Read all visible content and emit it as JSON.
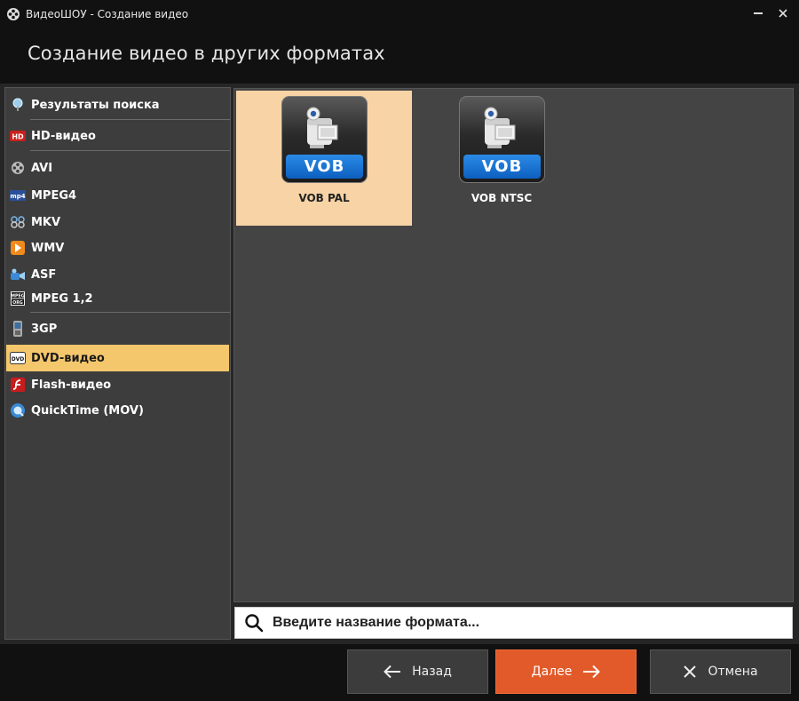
{
  "window": {
    "title": "ВидеоШОУ - Создание видео",
    "minimize_icon": "minimize-icon",
    "close_icon": "close-icon"
  },
  "header": {
    "heading": "Создание видео в других форматах"
  },
  "sidebar": {
    "items": [
      {
        "label": "Результаты поиска",
        "icon": "search-result-icon",
        "selected": false
      },
      {
        "label": "HD-видео",
        "icon": "hd-icon",
        "selected": false
      },
      {
        "label": "AVI",
        "icon": "film-reel-icon",
        "selected": false
      },
      {
        "label": "MPEG4",
        "icon": "mp4-icon",
        "selected": false
      },
      {
        "label": "MKV",
        "icon": "mkv-icon",
        "selected": false
      },
      {
        "label": "WMV",
        "icon": "wmv-icon",
        "selected": false
      },
      {
        "label": "ASF",
        "icon": "asf-icon",
        "selected": false
      },
      {
        "label": "MPEG 1,2",
        "icon": "mpeg-org-icon",
        "selected": false
      },
      {
        "label": "3GP",
        "icon": "phone-icon",
        "selected": false
      },
      {
        "label": "DVD-видео",
        "icon": "dvd-icon",
        "selected": true
      },
      {
        "label": "Flash-видео",
        "icon": "flash-icon",
        "selected": false
      },
      {
        "label": "QuickTime (MOV)",
        "icon": "quicktime-icon",
        "selected": false
      }
    ]
  },
  "formats": [
    {
      "label": "VOB PAL",
      "badge": "VOB",
      "icon": "camcorder-icon",
      "selected": true
    },
    {
      "label": "VOB NTSC",
      "badge": "VOB",
      "icon": "camcorder-icon",
      "selected": false
    }
  ],
  "search": {
    "placeholder": "Введите название формата...",
    "icon": "search-icon"
  },
  "buttons": {
    "back": "Назад",
    "next": "Далее",
    "cancel": "Отмена"
  },
  "colors": {
    "selected_item": "#f5c76c",
    "selected_tile": "#f7d3a6",
    "primary_button": "#e25a2a",
    "badge_blue": "#1a73d0"
  }
}
